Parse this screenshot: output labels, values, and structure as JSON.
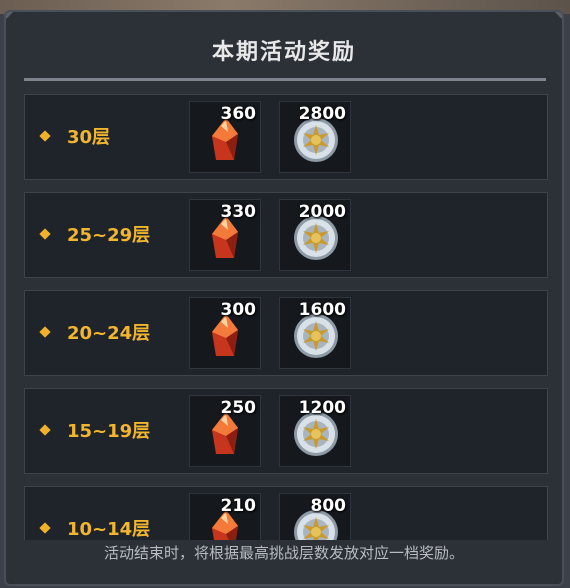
{
  "panel": {
    "title": "本期活动奖励",
    "footer_note": "活动结束时，将根据最高挑战层数发放对应一档奖励。"
  },
  "colors": {
    "tier_text": "#f2b52e",
    "panel_bg": "#2c3138",
    "row_bg": "#1f242a"
  },
  "rewards": [
    {
      "tier": "30层",
      "items": [
        {
          "icon": "red-crystal-icon",
          "count": "360"
        },
        {
          "icon": "silver-coin-icon",
          "count": "2800"
        }
      ]
    },
    {
      "tier": "25~29层",
      "items": [
        {
          "icon": "red-crystal-icon",
          "count": "330"
        },
        {
          "icon": "silver-coin-icon",
          "count": "2000"
        }
      ]
    },
    {
      "tier": "20~24层",
      "items": [
        {
          "icon": "red-crystal-icon",
          "count": "300"
        },
        {
          "icon": "silver-coin-icon",
          "count": "1600"
        }
      ]
    },
    {
      "tier": "15~19层",
      "items": [
        {
          "icon": "red-crystal-icon",
          "count": "250"
        },
        {
          "icon": "silver-coin-icon",
          "count": "1200"
        }
      ]
    },
    {
      "tier": "10~14层",
      "items": [
        {
          "icon": "red-crystal-icon",
          "count": "210"
        },
        {
          "icon": "silver-coin-icon",
          "count": "800"
        }
      ]
    }
  ]
}
